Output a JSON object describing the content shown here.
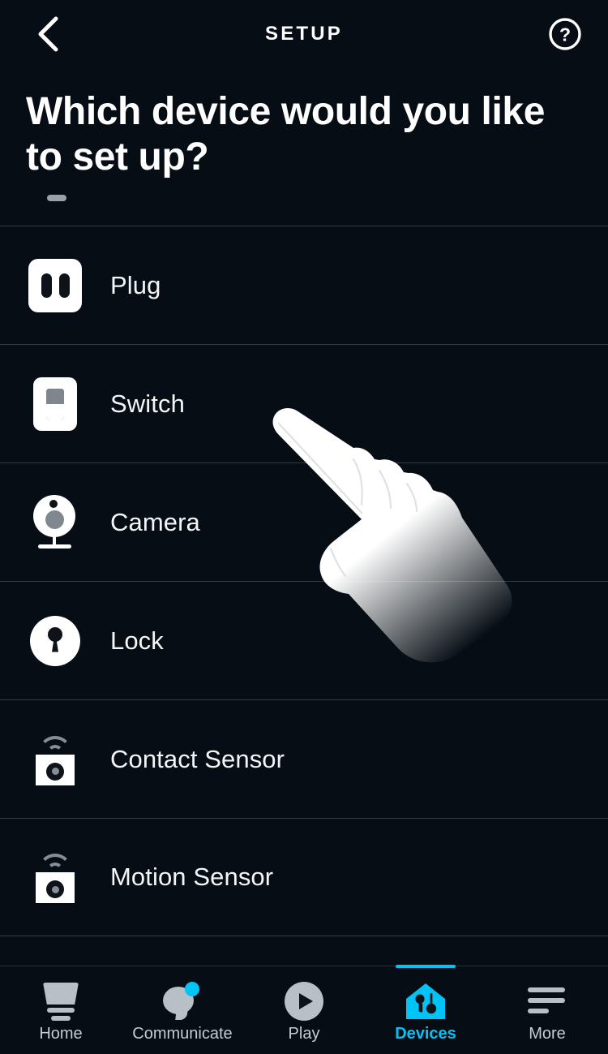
{
  "header": {
    "title": "SETUP",
    "back_icon": "chevron-left-icon",
    "help_icon": "help-circle-icon"
  },
  "main": {
    "heading": "Which device would you like to set up?",
    "devices": [
      {
        "label": "Plug",
        "icon": "plug-outlet-icon"
      },
      {
        "label": "Switch",
        "icon": "light-switch-icon"
      },
      {
        "label": "Camera",
        "icon": "camera-icon"
      },
      {
        "label": "Lock",
        "icon": "lock-keyhole-icon"
      },
      {
        "label": "Contact Sensor",
        "icon": "contact-sensor-icon"
      },
      {
        "label": "Motion Sensor",
        "icon": "motion-sensor-icon"
      }
    ]
  },
  "cursor": {
    "icon": "pointing-hand-cursor"
  },
  "tabbar": {
    "active": "Devices",
    "items": [
      {
        "label": "Home",
        "icon": "home-icon",
        "active": false,
        "badge": false
      },
      {
        "label": "Communicate",
        "icon": "speech-bubble-icon",
        "active": false,
        "badge": true
      },
      {
        "label": "Play",
        "icon": "play-circle-icon",
        "active": false,
        "badge": false
      },
      {
        "label": "Devices",
        "icon": "devices-house-icon",
        "active": true,
        "badge": false
      },
      {
        "label": "More",
        "icon": "more-lines-icon",
        "active": false,
        "badge": false
      }
    ]
  },
  "colors": {
    "background": "#060d14",
    "accent": "#00c4f5",
    "text": "#ffffff",
    "muted": "#b8bfc6",
    "divider": "#343b42"
  }
}
